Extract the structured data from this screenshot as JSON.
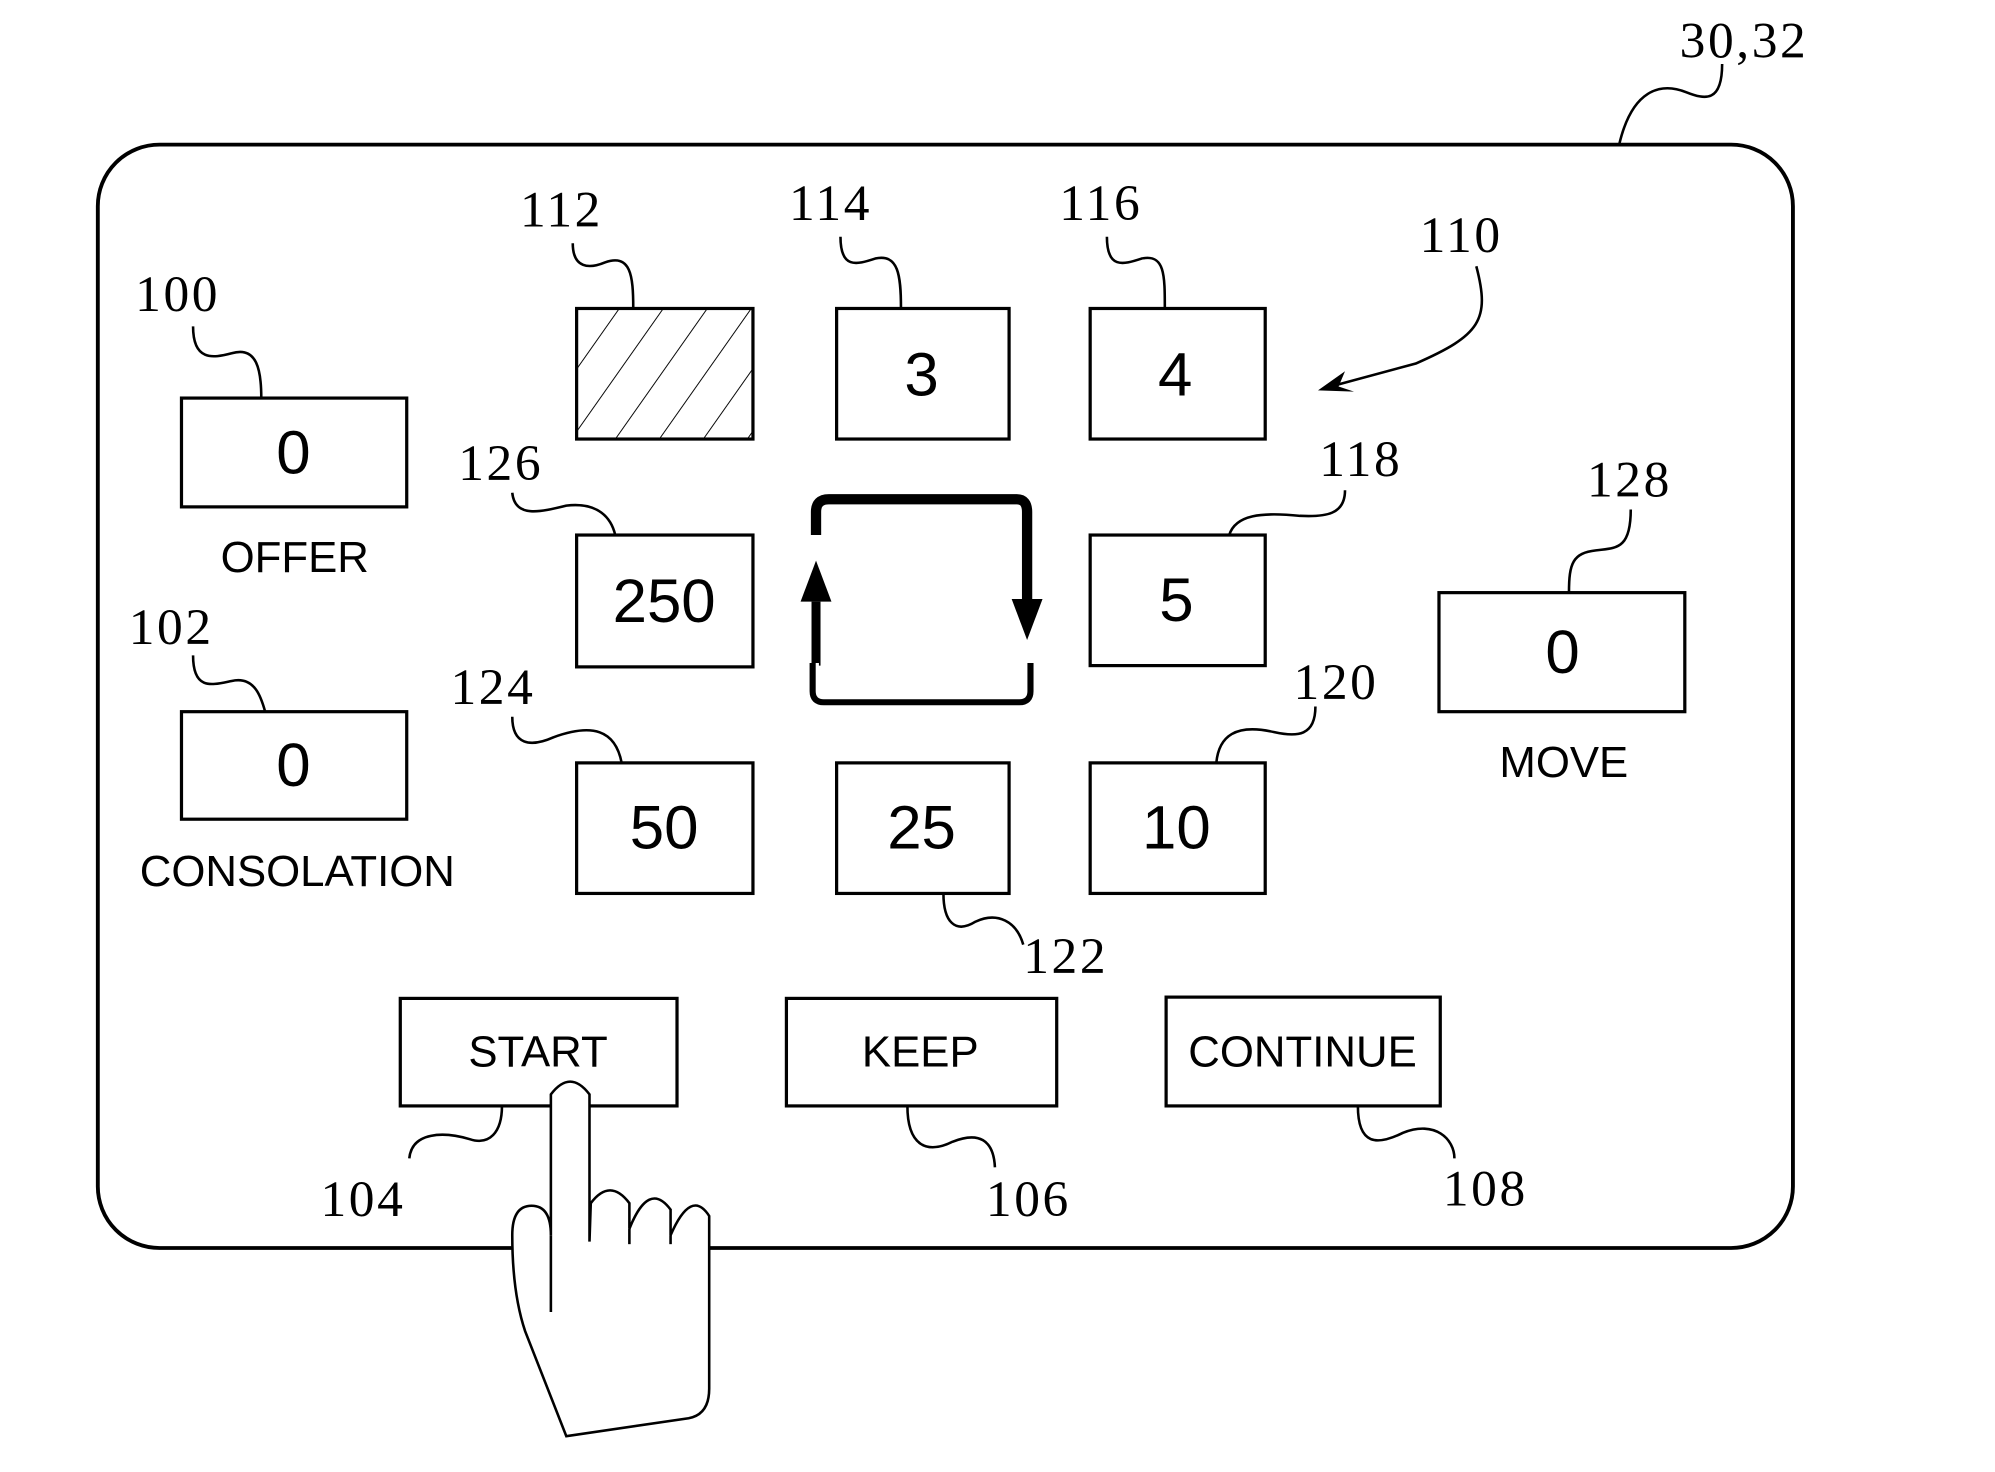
{
  "figure": {
    "device_ref": "30,32",
    "pointer_ref": "110"
  },
  "meters": [
    {
      "ref": "100",
      "value": "0",
      "label": "OFFER"
    },
    {
      "ref": "102",
      "value": "0",
      "label": "CONSOLATION"
    },
    {
      "ref": "128",
      "value": "0",
      "label": "MOVE"
    }
  ],
  "board_cells": [
    {
      "ref": "112",
      "value": "",
      "state": "highlighted"
    },
    {
      "ref": "114",
      "value": "3"
    },
    {
      "ref": "116",
      "value": "4"
    },
    {
      "ref": "118",
      "value": "5"
    },
    {
      "ref": "120",
      "value": "10"
    },
    {
      "ref": "122",
      "value": "25"
    },
    {
      "ref": "124",
      "value": "50"
    },
    {
      "ref": "126",
      "value": "250"
    }
  ],
  "buttons": [
    {
      "ref": "104",
      "label": "START"
    },
    {
      "ref": "106",
      "label": "KEEP"
    },
    {
      "ref": "108",
      "label": "CONTINUE"
    }
  ],
  "icons": {
    "center": "clockwise-cycle-arrow-icon",
    "hand": "pointing-hand-icon"
  }
}
